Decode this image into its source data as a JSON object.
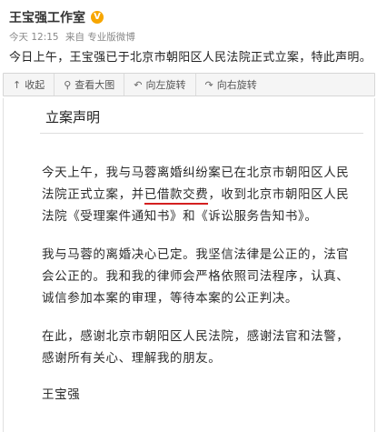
{
  "post": {
    "author": "王宝强工作室",
    "verified_badge": "V",
    "time": "今天 12:15",
    "source": "来自 专业版微博",
    "text": "今日上午，王宝强已于北京市朝阳区人民法院正式立案，特此声明。"
  },
  "toolbar": {
    "items": [
      {
        "icon": "collapse-icon",
        "glyph": "↑",
        "label": "收起"
      },
      {
        "icon": "magnify-icon",
        "glyph": "⚲",
        "label": "查看大图"
      },
      {
        "icon": "rotate-left-icon",
        "glyph": "↶",
        "label": "向左旋转"
      },
      {
        "icon": "rotate-right-icon",
        "glyph": "↷",
        "label": "向右旋转"
      }
    ]
  },
  "statement": {
    "title": "立案声明",
    "p1_a": "今天上午，我与马蓉离婚纠纷案已在北京市朝阳区人民法院正式立案，并",
    "p1_hl": "已借款交费",
    "p1_b": "，收到北京市朝阳区人民法院《受理案件通知书》和《诉讼服务告知书》。",
    "p2": "我与马蓉的离婚决心已定。我坚信法律是公正的，法官会公正的。我和我的律师会严格依照司法程序，认真、诚信参加本案的审理，等待本案的公正判决。",
    "p3": "在此，感谢北京市朝阳区人民法院，感谢法官和法警，感谢所有关心、理解我的朋友。",
    "signature": "王宝强"
  },
  "colors": {
    "highlight_underline": "#d42020",
    "badge": "#f7a600"
  }
}
